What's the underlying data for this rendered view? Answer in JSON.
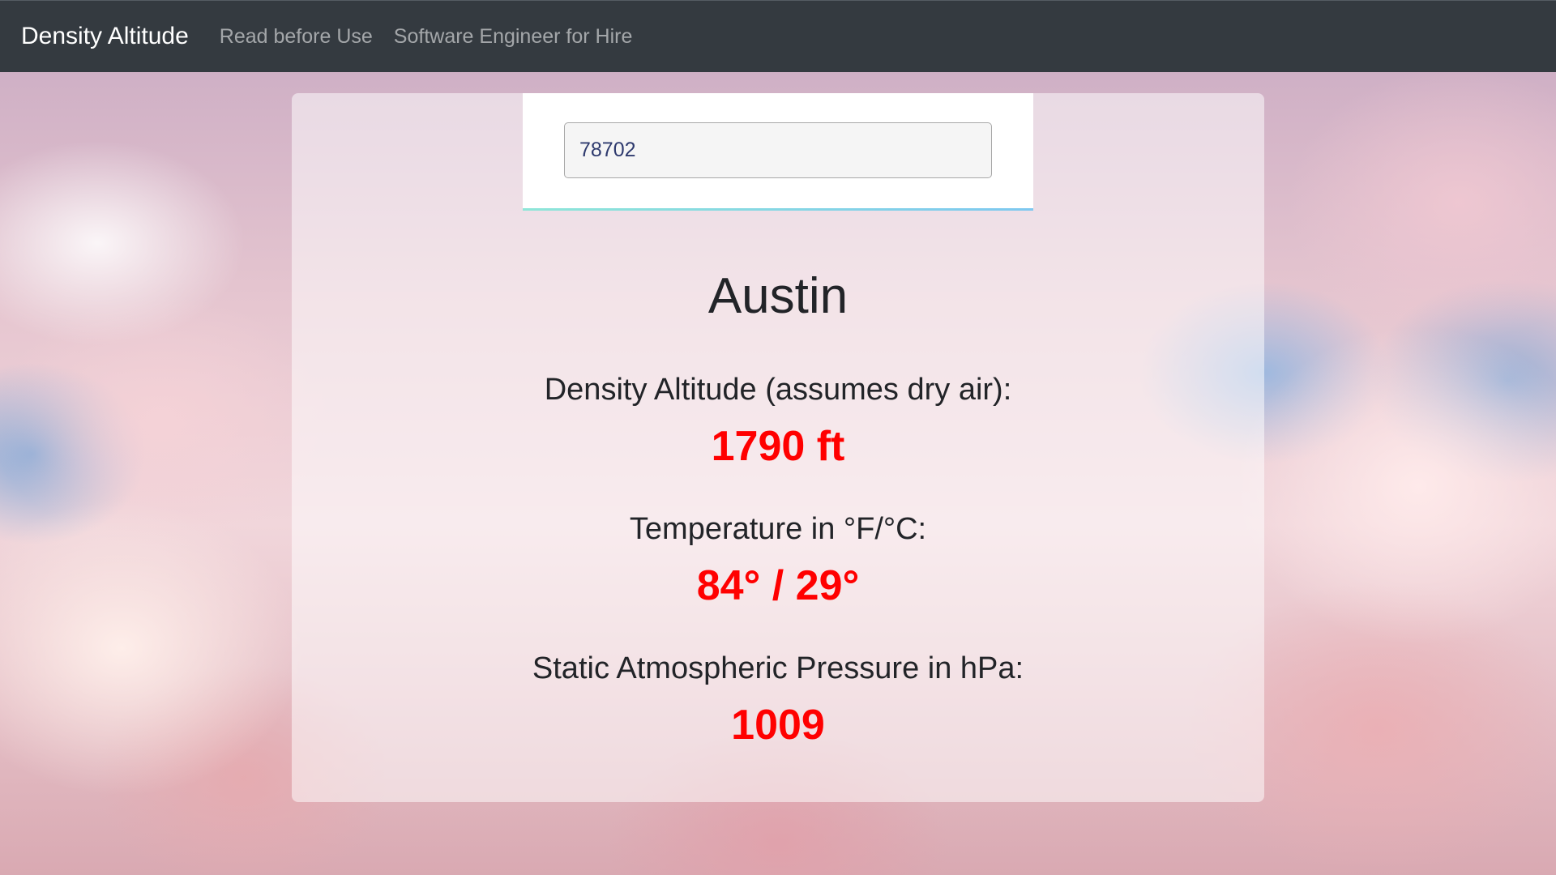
{
  "navbar": {
    "brand": "Density Altitude",
    "links": [
      "Read before Use",
      "Software Engineer for Hire"
    ]
  },
  "search": {
    "value": "78702"
  },
  "location": {
    "city": "Austin"
  },
  "metrics": {
    "density_altitude_label": "Density Altitude (assumes dry air):",
    "density_altitude_value": "1790 ft",
    "temperature_label": "Temperature in °F/°C:",
    "temperature_value": "84° / 29°",
    "pressure_label": "Static Atmospheric Pressure in hPa:",
    "pressure_value": "1009"
  },
  "colors": {
    "navbar": "#343a40",
    "value_red": "#ff0000"
  }
}
